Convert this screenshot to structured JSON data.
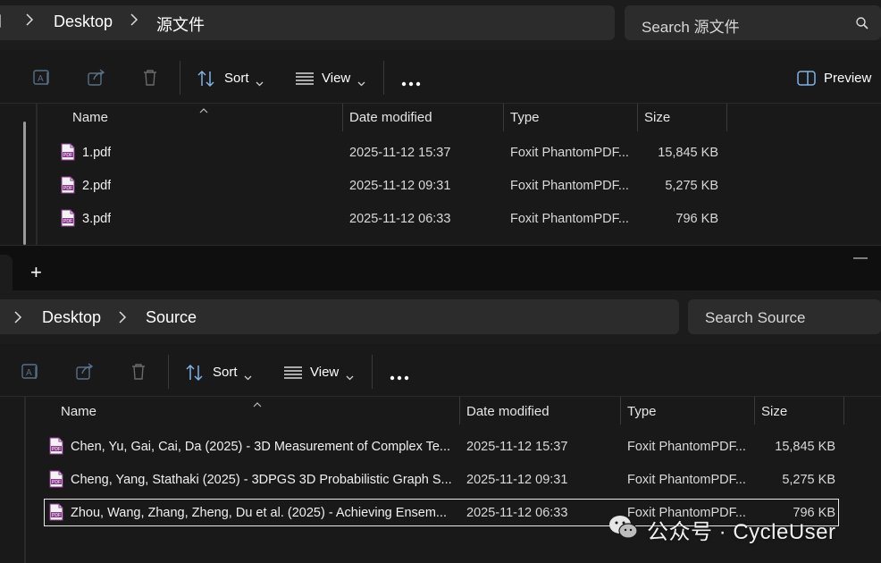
{
  "window1": {
    "breadcrumb": [
      "Desktop",
      "源文件"
    ],
    "search_placeholder": "Search 源文件",
    "toolbar": {
      "sort_label": "Sort",
      "view_label": "View",
      "preview_label": "Preview"
    },
    "columns": {
      "name": "Name",
      "date": "Date modified",
      "type": "Type",
      "size": "Size"
    },
    "files": [
      {
        "name": "1.pdf",
        "date": "2025-11-12 15:37",
        "type": "Foxit PhantomPDF...",
        "size": "15,845 KB"
      },
      {
        "name": "2.pdf",
        "date": "2025-11-12 09:31",
        "type": "Foxit PhantomPDF...",
        "size": "5,275 KB"
      },
      {
        "name": "3.pdf",
        "date": "2025-11-12 06:33",
        "type": "Foxit PhantomPDF...",
        "size": "796 KB"
      }
    ]
  },
  "window2": {
    "new_tab_label": "+",
    "minimize_label": "—",
    "breadcrumb": [
      "Desktop",
      "Source"
    ],
    "search_placeholder": "Search Source",
    "toolbar": {
      "sort_label": "Sort",
      "view_label": "View"
    },
    "columns": {
      "name": "Name",
      "date": "Date modified",
      "type": "Type",
      "size": "Size"
    },
    "files": [
      {
        "name": "Chen, Yu, Gai, Cai, Da (2025) - 3D Measurement of Complex Te...",
        "date": "2025-11-12 15:37",
        "type": "Foxit PhantomPDF...",
        "size": "15,845 KB"
      },
      {
        "name": "Cheng, Yang, Stathaki (2025) - 3DPGS 3D Probabilistic Graph S...",
        "date": "2025-11-12 09:31",
        "type": "Foxit PhantomPDF...",
        "size": "5,275 KB"
      },
      {
        "name": "Zhou, Wang, Zhang, Zheng, Du et al. (2025) - Achieving Ensem...",
        "date": "2025-11-12 06:33",
        "type": "Foxit PhantomPDF...",
        "size": "796 KB"
      }
    ]
  },
  "watermark": {
    "text": "公众号 · CycleUser"
  },
  "colors": {
    "pdf_icon_accent": "#8b3a8f",
    "selection_border": "#e8e8e8"
  }
}
